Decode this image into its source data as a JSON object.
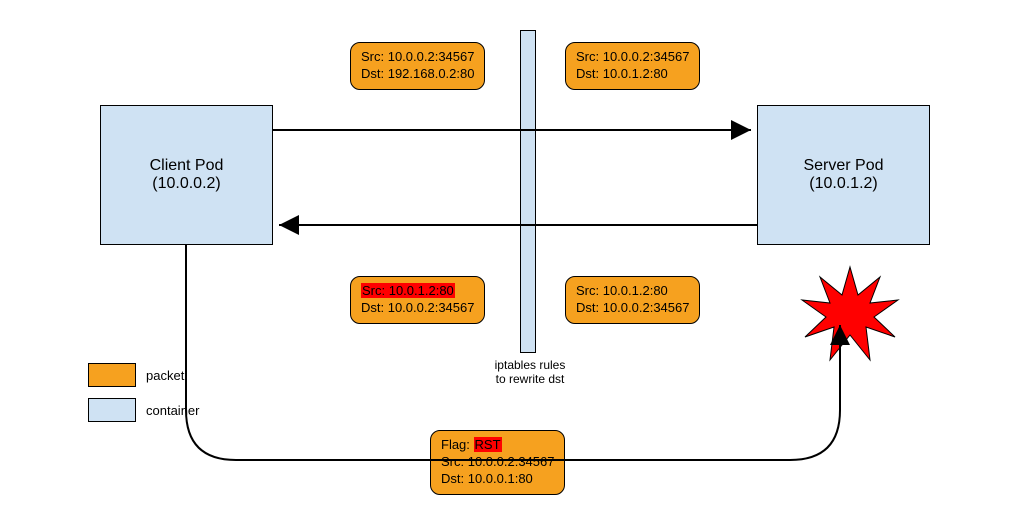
{
  "client_pod": {
    "name": "Client Pod",
    "ip": "(10.0.0.2)"
  },
  "server_pod": {
    "name": "Server Pod",
    "ip": "(10.0.1.2)"
  },
  "packet_top_left": {
    "src": "Src: 10.0.0.2:34567",
    "dst": "Dst: 192.168.0.2:80"
  },
  "packet_top_right": {
    "src": "Src: 10.0.0.2:34567",
    "dst": "Dst: 10.0.1.2:80"
  },
  "packet_mid_left": {
    "src_hl": "Src: 10.0.1.2:80",
    "dst": "Dst: 10.0.0.2:34567"
  },
  "packet_mid_right": {
    "src": "Src: 10.0.1.2:80",
    "dst": "Dst: 10.0.0.2:34567"
  },
  "packet_bottom": {
    "flag_prefix": "Flag: ",
    "flag_hl": "RST",
    "src": "Src: 10.0.0.2:34567",
    "dst": "Dst: 10.0.0.1:80"
  },
  "divider_label": "iptables rules\nto rewrite dst",
  "legend": {
    "packet": "packet",
    "container": "container"
  }
}
